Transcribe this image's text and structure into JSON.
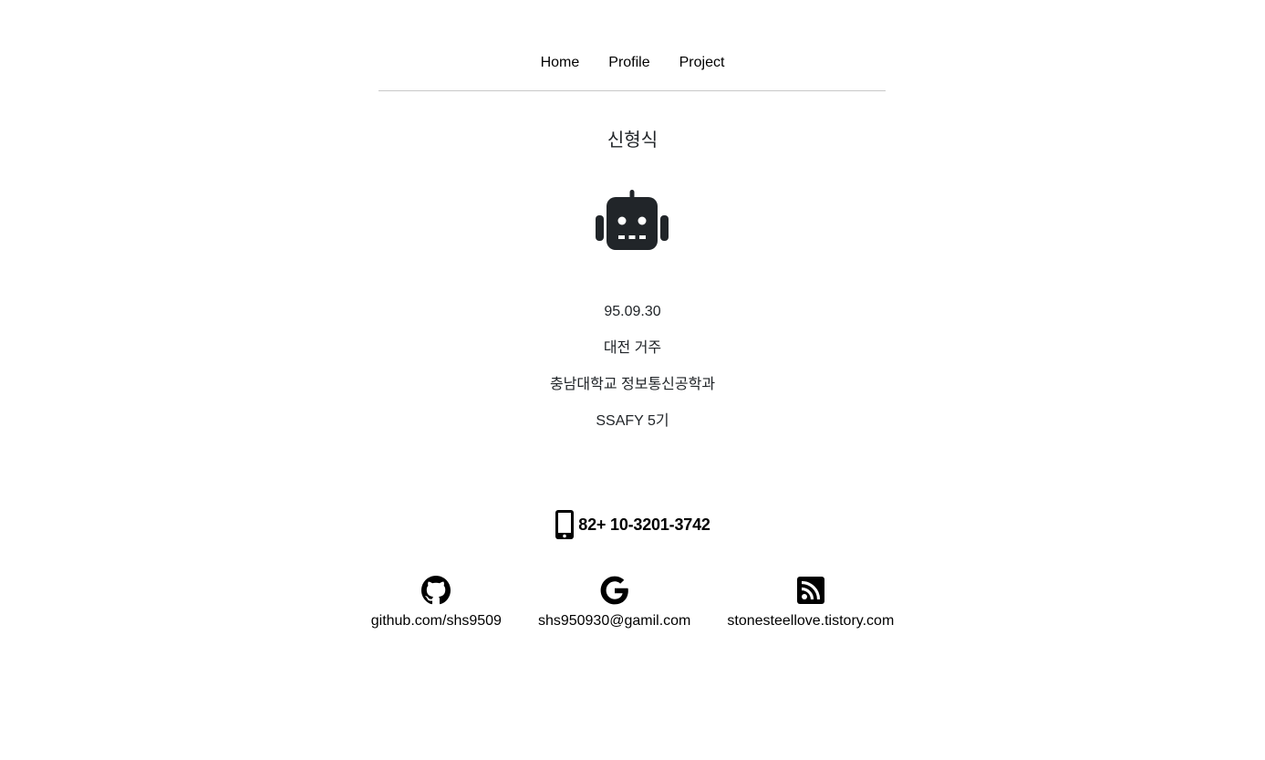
{
  "nav": {
    "items": [
      {
        "label": "Home"
      },
      {
        "label": "Profile"
      },
      {
        "label": "Project"
      }
    ]
  },
  "profile": {
    "name": "신형식",
    "avatar_icon": "robot-icon",
    "birthdate": "95.09.30",
    "residence": "대전 거주",
    "education": "충남대학교 정보통신공학과",
    "program": "SSAFY 5기"
  },
  "contact": {
    "phone_icon": "mobile-phone-icon",
    "phone": "82+ 10-3201-3742",
    "links": [
      {
        "icon": "github-icon",
        "label": "github.com/shs9509"
      },
      {
        "icon": "google-icon",
        "label": "shs950930@gamil.com"
      },
      {
        "icon": "rss-icon",
        "label": "stonesteellove.tistory.com"
      }
    ]
  },
  "colors": {
    "text": "#212529",
    "icon": "#212529",
    "divider": "#c8c8c8"
  }
}
